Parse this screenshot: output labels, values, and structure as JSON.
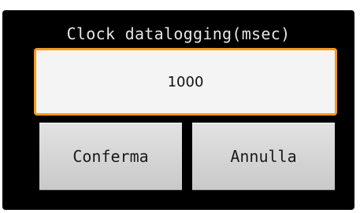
{
  "dialog": {
    "title": "Clock datalogging(msec)",
    "input": {
      "value": "1000"
    },
    "buttons": {
      "confirm_label": "Conferma",
      "cancel_label": "Annulla"
    }
  },
  "colors": {
    "dialog_bg": "#000000",
    "input_border_accent": "#f59a1e",
    "input_bg": "#f4f4f4",
    "button_bg": "#d6d6d6",
    "title_text": "#e6e6e6"
  }
}
